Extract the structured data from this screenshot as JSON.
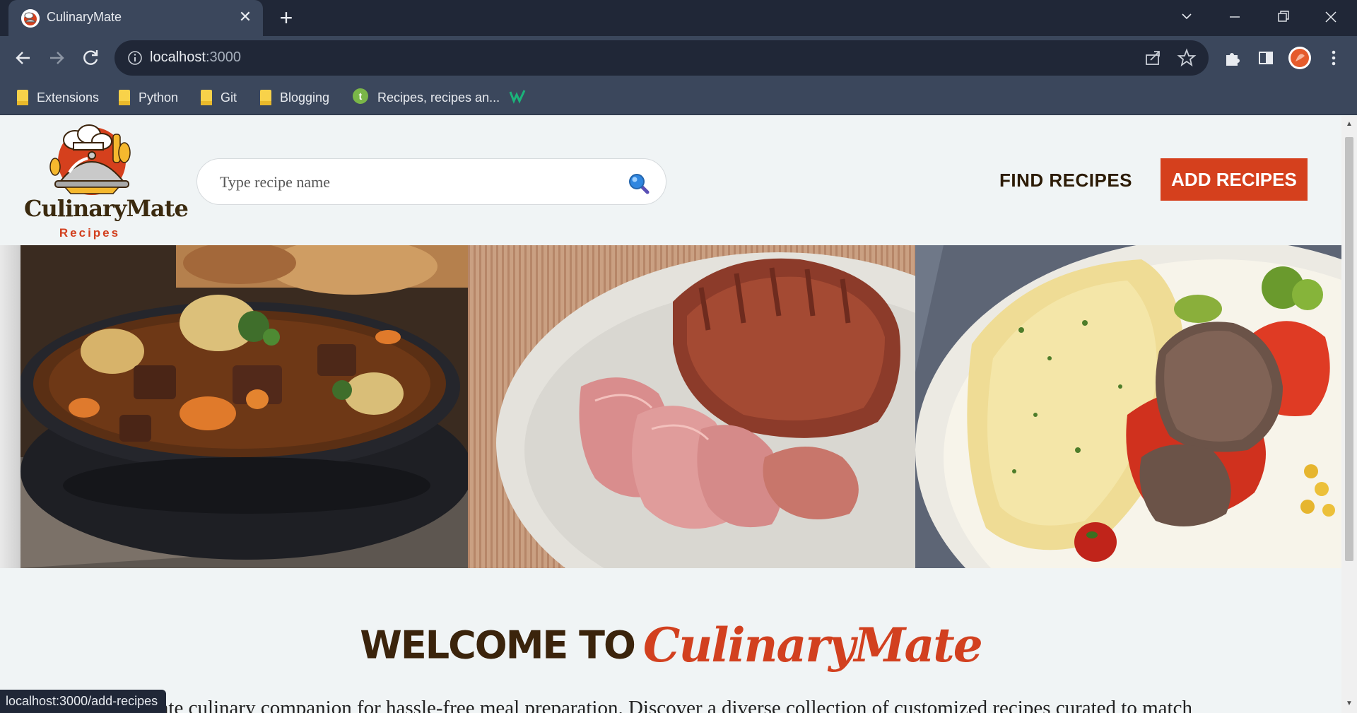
{
  "browser": {
    "tab": {
      "title": "CulinaryMate",
      "close_glyph": "✕"
    },
    "new_tab_glyph": "+",
    "address": {
      "host": "localhost",
      "port": ":3000"
    },
    "bookmarks": [
      {
        "label": "Extensions",
        "icon": "folder-icon"
      },
      {
        "label": "Python",
        "icon": "folder-icon"
      },
      {
        "label": "Git",
        "icon": "folder-icon"
      },
      {
        "label": "Blogging",
        "icon": "folder-icon"
      },
      {
        "label": "Recipes, recipes an...",
        "icon": "site-icon"
      },
      {
        "label": "",
        "icon": "w-site-icon"
      }
    ],
    "status_url": "localhost:3000/add-recipes"
  },
  "header": {
    "logo": {
      "word": "CulinaryMate",
      "sub": "Recipes"
    },
    "search": {
      "placeholder": "Type recipe name"
    },
    "nav": {
      "find": "FIND RECIPES",
      "add": "ADD RECIPES"
    }
  },
  "carousel": {
    "slides": [
      {
        "name": "beef-stew-image",
        "caption": ""
      },
      {
        "name": "roast-pork-image",
        "caption": ""
      },
      {
        "name": "steak-plate-image",
        "caption": ""
      }
    ]
  },
  "welcome": {
    "prefix": "WELCOME TO",
    "brand": "CulinaryMate",
    "intro": "nate culinary companion for hassle-free meal preparation. Discover a diverse collection of customized recipes curated to match"
  },
  "colors": {
    "accent": "#d5401d",
    "dark_brown": "#3b240c",
    "chrome": "#3b475c",
    "chrome_dark": "#202737"
  }
}
